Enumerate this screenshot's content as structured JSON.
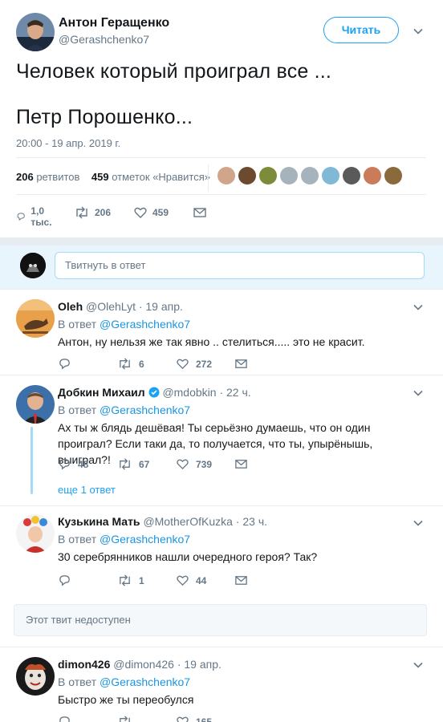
{
  "main_tweet": {
    "author_name": "Антон Геращенко",
    "author_handle": "@Gerashchenko7",
    "follow_label": "Читать",
    "text_line1": "Человек который проиграл все ...",
    "text_line2": "Петр Порошенко...",
    "datetime": "20:00 - 19 апр. 2019 г.",
    "retweets_count": "206",
    "retweets_label": "ретвитов",
    "likes_count": "459",
    "likes_label": "отметок «Нравится»",
    "actions": {
      "replies": "1,0 тыс.",
      "retweets": "206",
      "likes": "459"
    },
    "liker_avatar_colors": [
      "#d0a58a",
      "#6b4a30",
      "#7d8c3a",
      "#a7b3bc",
      "#a7b3bc",
      "#7fb9d6",
      "#5a5a5a",
      "#c97b5a",
      "#8a6a3a"
    ]
  },
  "composer": {
    "placeholder": "Твитнуть в ответ"
  },
  "replies": [
    {
      "name": "Oleh",
      "handle": "@OlehLyt · 19 апр.",
      "in_reply_prefix": "В ответ",
      "in_reply_handle": "@Gerashchenko7",
      "text": "Антон, ну нельзя же так явно .. стелиться..... это не красит.",
      "actions": {
        "replies": "",
        "retweets": "6",
        "likes": "272"
      }
    },
    {
      "name": "Добкин Михаил",
      "handle": "@mdobkin · 22 ч.",
      "in_reply_prefix": "В ответ",
      "in_reply_handle": "@Gerashchenko7",
      "text": "Ах ты ж блядь дешёвая! Ты серьёзно думаешь, что он один проиграл? Если таки да, то получается, что ты, упырёнышь, выиграл?!",
      "actions": {
        "replies": "48",
        "retweets": "67",
        "likes": "739"
      },
      "more_replies": "еще 1 ответ"
    },
    {
      "name": "Кузькина Мать",
      "handle": "@MotherOfKuzka · 23 ч.",
      "in_reply_prefix": "В ответ",
      "in_reply_handle": "@Gerashchenko7",
      "text": "30 серебрянников нашли очередного героя? Так?",
      "actions": {
        "replies": "",
        "retweets": "1",
        "likes": "44"
      }
    },
    {
      "name": "dimon426",
      "handle": "@dimon426 · 19 апр.",
      "in_reply_prefix": "В ответ",
      "in_reply_handle": "@Gerashchenko7",
      "text": "Быстро же ты переобулся",
      "actions": {
        "replies": "",
        "retweets": "",
        "likes": "165"
      }
    }
  ],
  "unavailable_notice": "Этот твит недоступен",
  "colors": {
    "accent": "#1da1f2",
    "link": "#1b95e0",
    "muted": "#657786",
    "border": "#e6ecf0"
  }
}
